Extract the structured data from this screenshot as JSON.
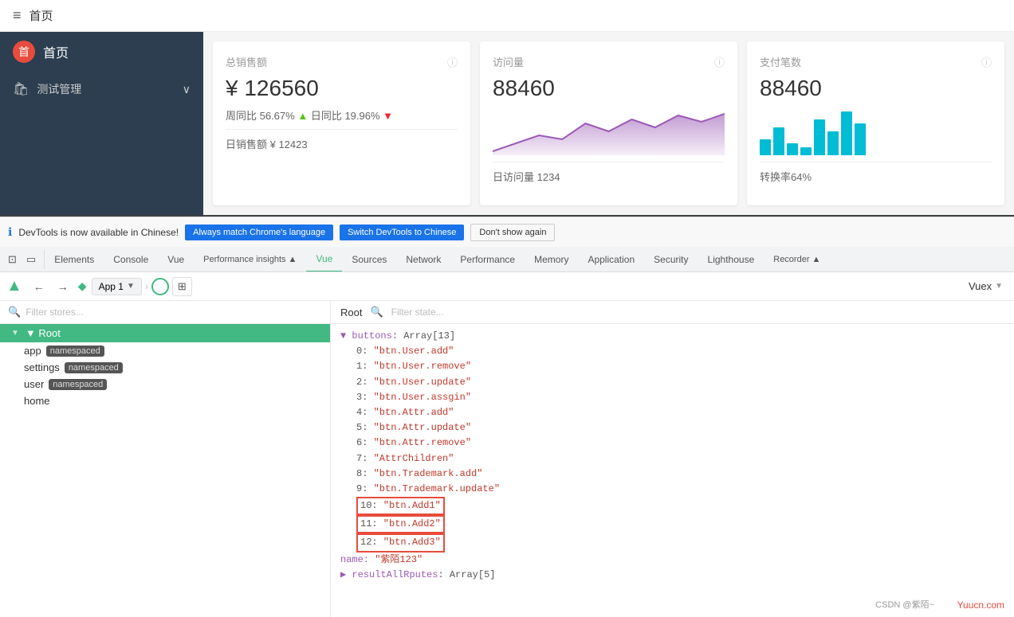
{
  "sidebar": {
    "logo_char": "首",
    "title": "首页",
    "menu_item_1_label": "测试管理",
    "menu_item_1_arrow": "∨"
  },
  "page_header": {
    "hamburger": "≡",
    "title": "首页"
  },
  "cards": {
    "card1": {
      "title": "总销售额",
      "value": "¥ 126560",
      "sub1": "周同比 56.67%",
      "up": "▲",
      "sub2": " 日同比 19.96%",
      "down": "▼",
      "footer": "日销售额 ¥ 12423"
    },
    "card2": {
      "title": "访问量",
      "value": "88460",
      "footer": "日访问量 1234"
    },
    "card3": {
      "title": "支付笔数",
      "value": "88460",
      "footer": "转换率64%"
    }
  },
  "devtools": {
    "notif_text": "DevTools is now available in Chinese!",
    "btn_match_label": "Always match Chrome's language",
    "btn_switch_label": "Switch DevTools to Chinese",
    "btn_dismiss_label": "Don't show again",
    "tabs": [
      "Elements",
      "Console",
      "Vue",
      "Performance insights ▲",
      "Vue",
      "Sources",
      "Network",
      "Performance",
      "Memory",
      "Application",
      "Security",
      "Lighthouse",
      "Recorder ▲"
    ],
    "active_tab": "Vue",
    "vue_bar": {
      "back": "←",
      "forward": "→",
      "app": "App 1",
      "vuex": "Vuex"
    }
  },
  "stores": {
    "filter_placeholder": "Filter stores...",
    "root_label": "▼ Root",
    "items": [
      {
        "label": "app",
        "badge": "namespaced"
      },
      {
        "label": "settings",
        "badge": "namespaced"
      },
      {
        "label": "user",
        "badge": "namespaced"
      },
      {
        "label": "home",
        "badge": null
      }
    ]
  },
  "state": {
    "root_label": "Root",
    "filter_placeholder": "Filter state...",
    "code_lines": [
      {
        "indent": 0,
        "text": "▼ buttons: Array[13]"
      },
      {
        "indent": 1,
        "text": "0: \"btn.User.add\""
      },
      {
        "indent": 1,
        "text": "1: \"btn.User.remove\""
      },
      {
        "indent": 1,
        "text": "2: \"btn.User.update\""
      },
      {
        "indent": 1,
        "text": "3: \"btn.User.assgin\""
      },
      {
        "indent": 1,
        "text": "4: \"btn.Attr.add\""
      },
      {
        "indent": 1,
        "text": "5: \"btn.Attr.update\""
      },
      {
        "indent": 1,
        "text": "6: \"btn.Attr.remove\""
      },
      {
        "indent": 1,
        "text": "7: \"AttrChildren\""
      },
      {
        "indent": 1,
        "text": "8: \"btn.Trademark.add\""
      },
      {
        "indent": 1,
        "text": "9: \"btn.Trademark.update\""
      },
      {
        "indent": 1,
        "text": "10: \"btn.Add1\"",
        "highlight": true
      },
      {
        "indent": 1,
        "text": "11: \"btn.Add2\"",
        "highlight": true
      },
      {
        "indent": 1,
        "text": "12: \"btn.Add3\"",
        "highlight": true
      },
      {
        "indent": 0,
        "text": "name: \"紫陌123\""
      },
      {
        "indent": 0,
        "text": "▶ resultAllRputes: Array[5]"
      }
    ]
  },
  "attribution": "Yuucn.com",
  "attribution2": "CSDN @紫陌~"
}
